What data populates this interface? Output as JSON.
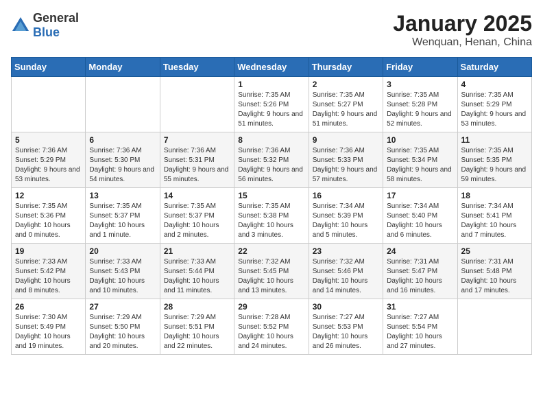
{
  "logo": {
    "general": "General",
    "blue": "Blue"
  },
  "title": "January 2025",
  "subtitle": "Wenquan, Henan, China",
  "weekdays": [
    "Sunday",
    "Monday",
    "Tuesday",
    "Wednesday",
    "Thursday",
    "Friday",
    "Saturday"
  ],
  "weeks": [
    [
      {
        "day": "",
        "detail": ""
      },
      {
        "day": "",
        "detail": ""
      },
      {
        "day": "",
        "detail": ""
      },
      {
        "day": "1",
        "detail": "Sunrise: 7:35 AM\nSunset: 5:26 PM\nDaylight: 9 hours and 51 minutes."
      },
      {
        "day": "2",
        "detail": "Sunrise: 7:35 AM\nSunset: 5:27 PM\nDaylight: 9 hours and 51 minutes."
      },
      {
        "day": "3",
        "detail": "Sunrise: 7:35 AM\nSunset: 5:28 PM\nDaylight: 9 hours and 52 minutes."
      },
      {
        "day": "4",
        "detail": "Sunrise: 7:35 AM\nSunset: 5:29 PM\nDaylight: 9 hours and 53 minutes."
      }
    ],
    [
      {
        "day": "5",
        "detail": "Sunrise: 7:36 AM\nSunset: 5:29 PM\nDaylight: 9 hours and 53 minutes."
      },
      {
        "day": "6",
        "detail": "Sunrise: 7:36 AM\nSunset: 5:30 PM\nDaylight: 9 hours and 54 minutes."
      },
      {
        "day": "7",
        "detail": "Sunrise: 7:36 AM\nSunset: 5:31 PM\nDaylight: 9 hours and 55 minutes."
      },
      {
        "day": "8",
        "detail": "Sunrise: 7:36 AM\nSunset: 5:32 PM\nDaylight: 9 hours and 56 minutes."
      },
      {
        "day": "9",
        "detail": "Sunrise: 7:36 AM\nSunset: 5:33 PM\nDaylight: 9 hours and 57 minutes."
      },
      {
        "day": "10",
        "detail": "Sunrise: 7:35 AM\nSunset: 5:34 PM\nDaylight: 9 hours and 58 minutes."
      },
      {
        "day": "11",
        "detail": "Sunrise: 7:35 AM\nSunset: 5:35 PM\nDaylight: 9 hours and 59 minutes."
      }
    ],
    [
      {
        "day": "12",
        "detail": "Sunrise: 7:35 AM\nSunset: 5:36 PM\nDaylight: 10 hours and 0 minutes."
      },
      {
        "day": "13",
        "detail": "Sunrise: 7:35 AM\nSunset: 5:37 PM\nDaylight: 10 hours and 1 minute."
      },
      {
        "day": "14",
        "detail": "Sunrise: 7:35 AM\nSunset: 5:37 PM\nDaylight: 10 hours and 2 minutes."
      },
      {
        "day": "15",
        "detail": "Sunrise: 7:35 AM\nSunset: 5:38 PM\nDaylight: 10 hours and 3 minutes."
      },
      {
        "day": "16",
        "detail": "Sunrise: 7:34 AM\nSunset: 5:39 PM\nDaylight: 10 hours and 5 minutes."
      },
      {
        "day": "17",
        "detail": "Sunrise: 7:34 AM\nSunset: 5:40 PM\nDaylight: 10 hours and 6 minutes."
      },
      {
        "day": "18",
        "detail": "Sunrise: 7:34 AM\nSunset: 5:41 PM\nDaylight: 10 hours and 7 minutes."
      }
    ],
    [
      {
        "day": "19",
        "detail": "Sunrise: 7:33 AM\nSunset: 5:42 PM\nDaylight: 10 hours and 8 minutes."
      },
      {
        "day": "20",
        "detail": "Sunrise: 7:33 AM\nSunset: 5:43 PM\nDaylight: 10 hours and 10 minutes."
      },
      {
        "day": "21",
        "detail": "Sunrise: 7:33 AM\nSunset: 5:44 PM\nDaylight: 10 hours and 11 minutes."
      },
      {
        "day": "22",
        "detail": "Sunrise: 7:32 AM\nSunset: 5:45 PM\nDaylight: 10 hours and 13 minutes."
      },
      {
        "day": "23",
        "detail": "Sunrise: 7:32 AM\nSunset: 5:46 PM\nDaylight: 10 hours and 14 minutes."
      },
      {
        "day": "24",
        "detail": "Sunrise: 7:31 AM\nSunset: 5:47 PM\nDaylight: 10 hours and 16 minutes."
      },
      {
        "day": "25",
        "detail": "Sunrise: 7:31 AM\nSunset: 5:48 PM\nDaylight: 10 hours and 17 minutes."
      }
    ],
    [
      {
        "day": "26",
        "detail": "Sunrise: 7:30 AM\nSunset: 5:49 PM\nDaylight: 10 hours and 19 minutes."
      },
      {
        "day": "27",
        "detail": "Sunrise: 7:29 AM\nSunset: 5:50 PM\nDaylight: 10 hours and 20 minutes."
      },
      {
        "day": "28",
        "detail": "Sunrise: 7:29 AM\nSunset: 5:51 PM\nDaylight: 10 hours and 22 minutes."
      },
      {
        "day": "29",
        "detail": "Sunrise: 7:28 AM\nSunset: 5:52 PM\nDaylight: 10 hours and 24 minutes."
      },
      {
        "day": "30",
        "detail": "Sunrise: 7:27 AM\nSunset: 5:53 PM\nDaylight: 10 hours and 26 minutes."
      },
      {
        "day": "31",
        "detail": "Sunrise: 7:27 AM\nSunset: 5:54 PM\nDaylight: 10 hours and 27 minutes."
      },
      {
        "day": "",
        "detail": ""
      }
    ]
  ]
}
